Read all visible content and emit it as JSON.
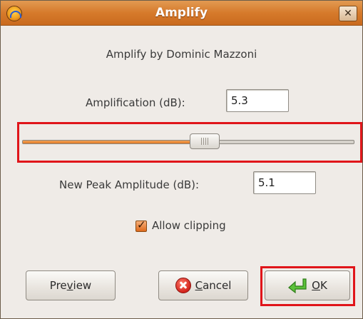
{
  "window": {
    "title": "Amplify",
    "close_label": "✕"
  },
  "header_text": "Amplify by Dominic Mazzoni",
  "amplification": {
    "label": "Amplification (dB):",
    "value": "5.3"
  },
  "slider": {
    "position_percent": 55
  },
  "new_peak": {
    "label": "New Peak Amplitude (dB):",
    "value": "5.1"
  },
  "allow_clipping": {
    "label": "Allow clipping",
    "checked": true
  },
  "buttons": {
    "preview_pre": "Pre",
    "preview_mnemonic": "v",
    "preview_post": "iew",
    "cancel_mnemonic": "C",
    "cancel_post": "ancel",
    "ok_mnemonic": "O",
    "ok_post": "K"
  },
  "colors": {
    "title_bar": "#d67a2b",
    "highlight": "#e0151a",
    "slider_fill": "#e07a26"
  },
  "icons": {
    "app": "audacity-icon",
    "cancel": "cancel-icon",
    "ok": "green-arrow-icon"
  }
}
